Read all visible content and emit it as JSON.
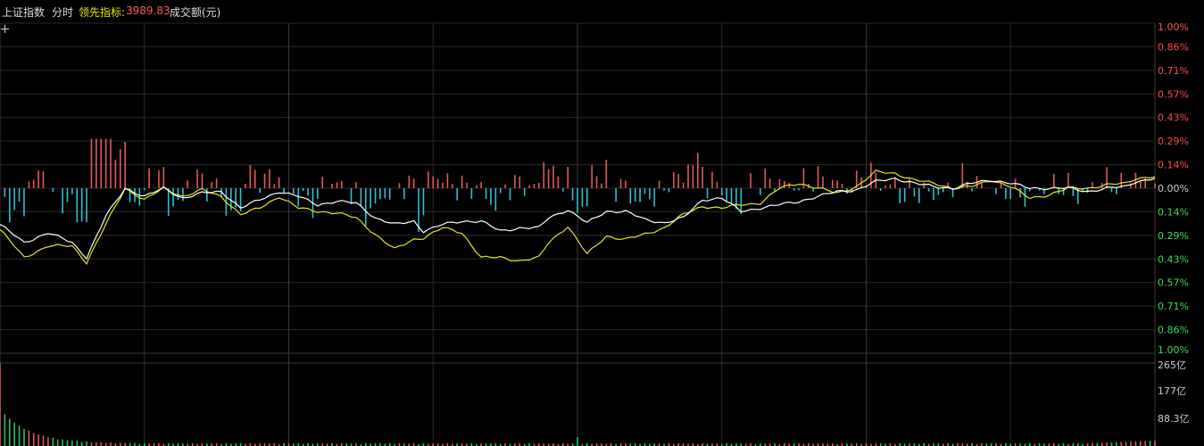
{
  "header": {
    "index_name": "上证指数",
    "period": "分时",
    "lead_label": "领先指标:",
    "lead_value": "3989.83",
    "volume_label": "成交额(元)"
  },
  "colors": {
    "background": "#000000",
    "grid": "#2a2a2a",
    "grid_major": "#3a3a3a",
    "price_line": "#ffffff",
    "lead_line": "#e6e619",
    "up": "#e05a5a",
    "down": "#2fc1d1",
    "vol_up": "#e05a5a",
    "vol_down": "#22c55e",
    "axis_up_text": "#ff4d4d",
    "axis_down_text": "#3ddc5a",
    "axis_zero_text": "#cccccc",
    "header_text": "#dddddd",
    "lead_text": "#e6e619",
    "lead_value_text": "#ff5a5a"
  },
  "chart_data": {
    "type": "line",
    "x_points": 241,
    "ylim": [
      -1.0,
      1.0
    ],
    "y_ticks_right": [
      "1.00%",
      "0.86%",
      "0.71%",
      "0.57%",
      "0.43%",
      "0.29%",
      "0.14%",
      "0.00%",
      "0.14%",
      "0.29%",
      "0.43%",
      "0.57%",
      "0.71%",
      "0.86%",
      "1.00%"
    ],
    "series": [
      {
        "key": "price",
        "keys": [
          [
            0,
            -0.22
          ],
          [
            5,
            -0.33
          ],
          [
            10,
            -0.27
          ],
          [
            15,
            -0.33
          ],
          [
            18,
            -0.42
          ],
          [
            22,
            -0.17
          ],
          [
            26,
            0.0
          ],
          [
            30,
            -0.05
          ],
          [
            34,
            0.0
          ],
          [
            38,
            -0.06
          ],
          [
            42,
            -0.03
          ],
          [
            46,
            -0.02
          ],
          [
            50,
            -0.12
          ],
          [
            54,
            -0.07
          ],
          [
            58,
            -0.02
          ],
          [
            62,
            -0.05
          ],
          [
            66,
            -0.1
          ],
          [
            70,
            -0.08
          ],
          [
            74,
            -0.09
          ],
          [
            78,
            -0.18
          ],
          [
            82,
            -0.22
          ],
          [
            86,
            -0.2
          ],
          [
            88,
            -0.26
          ],
          [
            92,
            -0.22
          ],
          [
            96,
            -0.2
          ],
          [
            100,
            -0.2
          ],
          [
            104,
            -0.26
          ],
          [
            108,
            -0.24
          ],
          [
            112,
            -0.24
          ],
          [
            114,
            -0.18
          ],
          [
            118,
            -0.13
          ],
          [
            122,
            -0.21
          ],
          [
            126,
            -0.14
          ],
          [
            130,
            -0.14
          ],
          [
            134,
            -0.19
          ],
          [
            138,
            -0.21
          ],
          [
            142,
            -0.18
          ],
          [
            146,
            -0.07
          ],
          [
            150,
            -0.06
          ],
          [
            154,
            -0.14
          ],
          [
            158,
            -0.12
          ],
          [
            162,
            -0.1
          ],
          [
            166,
            -0.08
          ],
          [
            170,
            -0.05
          ],
          [
            174,
            -0.02
          ],
          [
            178,
            -0.01
          ],
          [
            182,
            0.04
          ],
          [
            186,
            0.06
          ],
          [
            190,
            0.03
          ],
          [
            194,
            0.01
          ],
          [
            198,
            0.0
          ],
          [
            202,
            0.03
          ],
          [
            206,
            0.05
          ],
          [
            210,
            0.03
          ],
          [
            214,
            0.0
          ],
          [
            218,
            0.0
          ],
          [
            222,
            0.0
          ],
          [
            226,
            -0.02
          ],
          [
            230,
            0.0
          ],
          [
            234,
            0.01
          ],
          [
            236,
            0.04
          ],
          [
            240,
            0.06
          ]
        ]
      },
      {
        "key": "lead",
        "keys": [
          [
            0,
            -0.25
          ],
          [
            5,
            -0.42
          ],
          [
            10,
            -0.35
          ],
          [
            15,
            -0.35
          ],
          [
            18,
            -0.45
          ],
          [
            22,
            -0.22
          ],
          [
            26,
            0.0
          ],
          [
            30,
            -0.07
          ],
          [
            34,
            0.0
          ],
          [
            38,
            -0.05
          ],
          [
            42,
            -0.01
          ],
          [
            46,
            -0.05
          ],
          [
            50,
            -0.16
          ],
          [
            54,
            -0.12
          ],
          [
            58,
            -0.05
          ],
          [
            62,
            -0.12
          ],
          [
            66,
            -0.14
          ],
          [
            70,
            -0.15
          ],
          [
            74,
            -0.18
          ],
          [
            78,
            -0.28
          ],
          [
            82,
            -0.37
          ],
          [
            86,
            -0.31
          ],
          [
            88,
            -0.3
          ],
          [
            92,
            -0.24
          ],
          [
            96,
            -0.27
          ],
          [
            100,
            -0.42
          ],
          [
            104,
            -0.42
          ],
          [
            108,
            -0.44
          ],
          [
            112,
            -0.42
          ],
          [
            114,
            -0.33
          ],
          [
            118,
            -0.23
          ],
          [
            122,
            -0.4
          ],
          [
            126,
            -0.29
          ],
          [
            130,
            -0.31
          ],
          [
            134,
            -0.28
          ],
          [
            138,
            -0.24
          ],
          [
            142,
            -0.16
          ],
          [
            146,
            -0.11
          ],
          [
            150,
            -0.12
          ],
          [
            154,
            -0.1
          ],
          [
            158,
            -0.09
          ],
          [
            162,
            0.0
          ],
          [
            166,
            0.03
          ],
          [
            170,
            0.0
          ],
          [
            174,
            -0.03
          ],
          [
            178,
            0.01
          ],
          [
            182,
            0.1
          ],
          [
            186,
            0.09
          ],
          [
            190,
            0.05
          ],
          [
            194,
            0.03
          ],
          [
            198,
            0.0
          ],
          [
            202,
            0.01
          ],
          [
            206,
            0.05
          ],
          [
            210,
            0.01
          ],
          [
            214,
            -0.06
          ],
          [
            218,
            -0.04
          ],
          [
            222,
            0.0
          ],
          [
            226,
            0.0
          ],
          [
            230,
            0.02
          ],
          [
            234,
            0.03
          ],
          [
            236,
            0.06
          ],
          [
            240,
            0.07
          ]
        ]
      }
    ],
    "volume_axis_labels": [
      "265亿",
      "177亿",
      "88.3亿"
    ],
    "volume_ylim": [
      0,
      265
    ]
  }
}
